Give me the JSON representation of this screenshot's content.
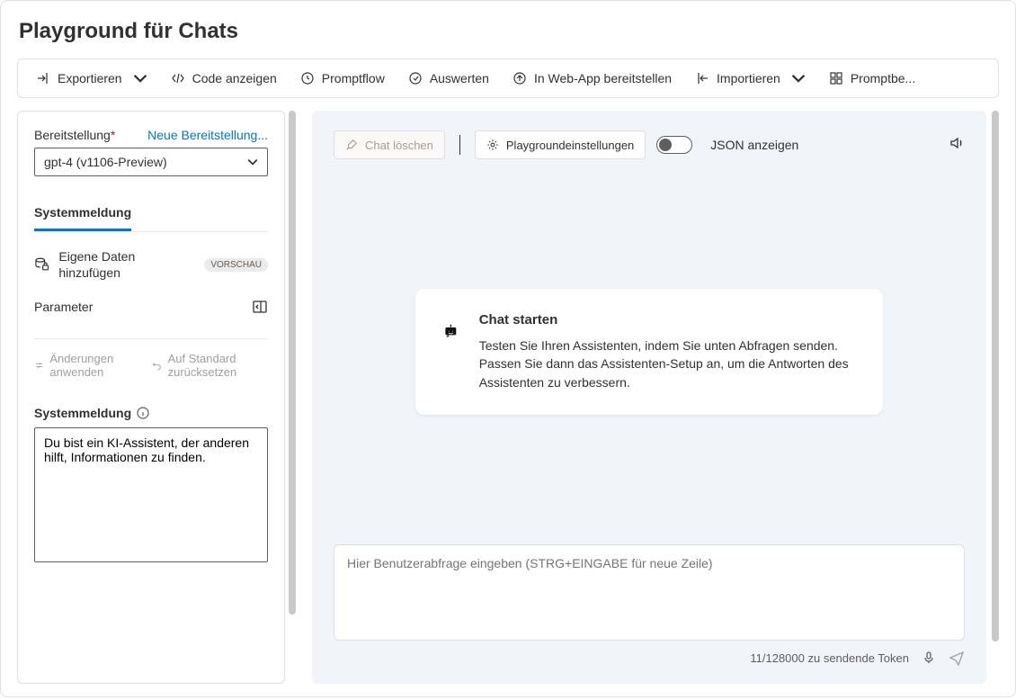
{
  "pageTitle": "Playground für Chats",
  "toolbar": {
    "export": "Exportieren",
    "showCode": "Code anzeigen",
    "promptflow": "Promptflow",
    "evaluate": "Auswerten",
    "deploy": "In Web-App bereitstellen",
    "import": "Importieren",
    "promptbe": "Promptbe..."
  },
  "sidebar": {
    "deploymentLabel": "Bereitstellung",
    "newDeployment": "Neue Bereitstellung...",
    "deploymentValue": "gpt-4 (v1106-Preview)",
    "tabSystem": "Systemmeldung",
    "addOwnData": "Eigene Daten hinzufügen",
    "previewBadge": "VORSCHAU",
    "parameter": "Parameter",
    "applyChanges": "Änderungen anwenden",
    "resetDefault": "Auf Standard zurücksetzen",
    "systemMessageHeading": "Systemmeldung",
    "systemMessageValue": "Du bist ein KI-Assistent, der anderen hilft, Informationen zu finden."
  },
  "chat": {
    "clear": "Chat löschen",
    "settings": "Playgroundeinstellungen",
    "jsonToggle": "JSON anzeigen",
    "startHeading": "Chat starten",
    "startBody": "Testen Sie Ihren Assistenten, indem Sie unten Abfragen senden. Passen Sie dann das Assistenten-Setup an, um die Antworten des Assistenten zu verbessern.",
    "inputPlaceholder": "Hier Benutzerabfrage eingeben (STRG+EINGABE für neue Zeile)",
    "tokenInfo": "11/128000 zu sendende Token"
  }
}
